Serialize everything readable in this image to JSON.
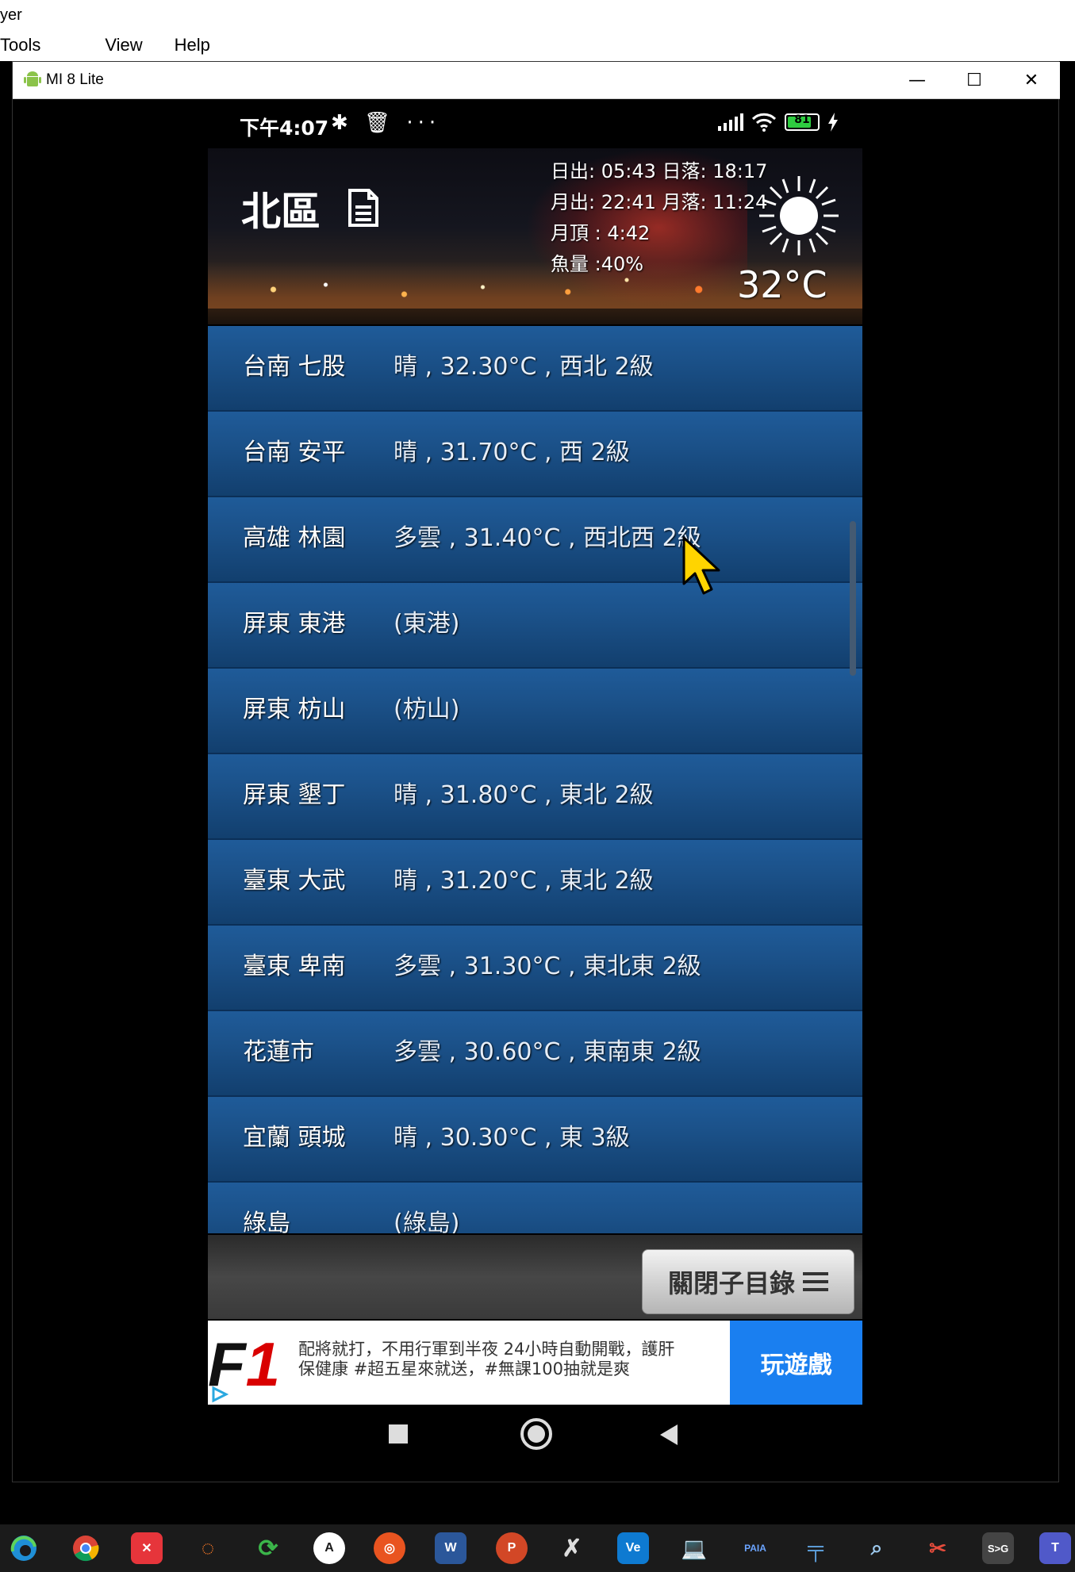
{
  "host": {
    "title": "yer",
    "menu": [
      "Tools",
      "View",
      "Help"
    ]
  },
  "window": {
    "title": "MI 8 Lite",
    "minimize": "—",
    "maximize": "☐",
    "close": "✕"
  },
  "statusbar": {
    "time": "下午4:07",
    "left_icons": "✱ 🗑 ···",
    "battery": "81",
    "battery_level": 0.81
  },
  "header": {
    "region": "北區",
    "sunrise": "日出: 05:43 日落: 18:17",
    "moonrise": "月出: 22:41 月落: 11:24",
    "moon_zenith": "月頂 : 4:42",
    "fish": "魚量 :40%",
    "temperature": "32°C",
    "icons": [
      "document-icon",
      "sun-icon"
    ]
  },
  "stations": [
    {
      "station": "台南 七股",
      "weather": "晴 , 32.30°C , 西北 2級"
    },
    {
      "station": "台南 安平",
      "weather": "晴 , 31.70°C , 西 2級"
    },
    {
      "station": "高雄 林園",
      "weather": "多雲 , 31.40°C , 西北西 2級"
    },
    {
      "station": "屏東 東港",
      "weather": "(東港)"
    },
    {
      "station": "屏東 枋山",
      "weather": "(枋山)"
    },
    {
      "station": "屏東 墾丁",
      "weather": "晴 , 31.80°C , 東北 2級"
    },
    {
      "station": "臺東 大武",
      "weather": "晴 , 31.20°C , 東北 2級"
    },
    {
      "station": "臺東 卑南",
      "weather": "多雲 , 31.30°C , 東北東 2級"
    },
    {
      "station": "花蓮市",
      "weather": "多雲 , 30.60°C , 東南東 2級"
    },
    {
      "station": "宜蘭 頭城",
      "weather": "晴 , 30.30°C , 東 3級"
    },
    {
      "station": "綠島",
      "weather": "(綠島)"
    }
  ],
  "bottom": {
    "close_submenu": "關閉子目錄"
  },
  "ad": {
    "logo_f": "F",
    "logo_1": "1",
    "line1": "配將就打，不用行軍到半夜 24小時自動開戰，護肝",
    "line2": "保健康 #超五星來就送，#無課100抽就是爽",
    "cta": "玩遊戲"
  },
  "taskbar": {
    "apps": [
      "edge-icon",
      "chrome-icon",
      "xmind-icon",
      "jupyter-icon",
      "sync-icon",
      "app-icon",
      "ubuntu-icon",
      "word-icon",
      "powerpoint-icon",
      "x-icon",
      "vscode-icon",
      "emulator-icon",
      "paia-icon",
      "tool-icon",
      "search-tool-icon",
      "snip-icon",
      "sg-icon",
      "teams-icon"
    ],
    "paia_label": "PAIA",
    "ve_label": "Ve",
    "sg_label": "S>G",
    "w_label": "W",
    "p_label": "P",
    "t_label": "T"
  }
}
